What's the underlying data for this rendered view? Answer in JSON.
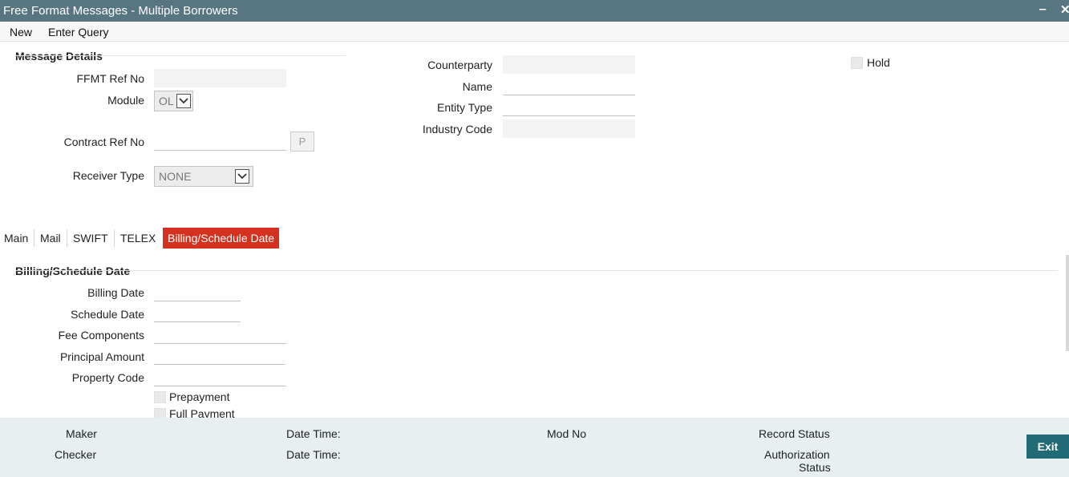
{
  "window": {
    "title": "Free Format Messages - Multiple Borrowers",
    "minimize_label": "‒",
    "close_label": "✕"
  },
  "menu": {
    "new_label": "New",
    "enter_query_label": "Enter Query"
  },
  "message_details": {
    "section_title": "Message Details",
    "ffmt_ref_no_label": "FFMT Ref No",
    "ffmt_ref_no_value": "",
    "module_label": "Module",
    "module_value": "OL",
    "contract_ref_no_label": "Contract Ref No",
    "contract_ref_no_value": "",
    "lov_button_label": "P",
    "receiver_type_label": "Receiver Type",
    "receiver_type_value": "NONE",
    "counterparty_label": "Counterparty",
    "counterparty_value": "",
    "name_label": "Name",
    "name_value": "",
    "entity_type_label": "Entity Type",
    "entity_type_value": "",
    "industry_code_label": "Industry Code",
    "industry_code_value": "",
    "hold_label": "Hold"
  },
  "tabs": [
    {
      "label": "Main",
      "active": false
    },
    {
      "label": "Mail",
      "active": false
    },
    {
      "label": "SWIFT",
      "active": false
    },
    {
      "label": "TELEX",
      "active": false
    },
    {
      "label": "Billing/Schedule Date",
      "active": true
    }
  ],
  "billing": {
    "section_title": "Billing/Schedule Date",
    "billing_date_label": "Billing Date",
    "schedule_date_label": "Schedule Date",
    "fee_components_label": "Fee Components",
    "principal_amount_label": "Principal Amount",
    "property_code_label": "Property Code",
    "prepayment_label": "Prepayment",
    "full_payment_label": "Full Payment"
  },
  "footer": {
    "maker_label": "Maker",
    "checker_label": "Checker",
    "date_time_label": "Date Time:",
    "mod_no_label": "Mod No",
    "record_status_label": "Record Status",
    "authorization_label": "Authorization",
    "status_label": "Status",
    "exit_label": "Exit"
  },
  "colors": {
    "titlebar": "#587582",
    "active_tab": "#d4321f",
    "exit_button": "#216b76",
    "footer": "#e7eff0"
  }
}
